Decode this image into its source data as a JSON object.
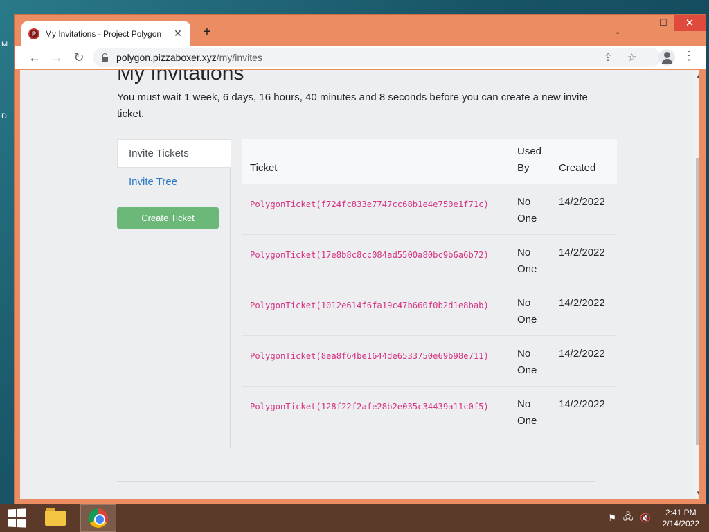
{
  "desktop": {
    "label_top": "M",
    "label_mid": "D"
  },
  "window": {
    "caption": {
      "minimize": "—",
      "maximize": "☐",
      "close": "✕"
    },
    "tab": {
      "title": "My Invitations - Project Polygon",
      "close": "✕",
      "favicon_letter": "P"
    },
    "new_tab": "+",
    "tab_search": "⌄",
    "toolbar": {
      "url_host": "polygon.pizzaboxer.xyz",
      "url_path": "/my/invites"
    }
  },
  "page": {
    "title": "My Invitations",
    "wait_message": "You must wait 1 week, 6 days, 16 hours, 40 minutes and 8 seconds before you can create a new invite ticket.",
    "sidebar": {
      "active_item": "Invite Tickets",
      "link_item": "Invite Tree",
      "create_button": "Create Ticket"
    },
    "table": {
      "headers": {
        "ticket": "Ticket",
        "used_by": "Used By",
        "created": "Created"
      },
      "rows": [
        {
          "ticket": "PolygonTicket(f724fc833e7747cc68b1e4e750e1f71c)",
          "used_by": "No One",
          "created": "14/2/2022"
        },
        {
          "ticket": "PolygonTicket(17e8b8c8cc084ad5500a80bc9b6a6b72)",
          "used_by": "No One",
          "created": "14/2/2022"
        },
        {
          "ticket": "PolygonTicket(1012e614f6fa19c47b660f0b2d1e8bab)",
          "used_by": "No One",
          "created": "14/2/2022"
        },
        {
          "ticket": "PolygonTicket(8ea8f64be1644de6533750e69b98e711)",
          "used_by": "No One",
          "created": "14/2/2022"
        },
        {
          "ticket": "PolygonTicket(128f22f2afe28b2e035c34439a11c0f5)",
          "used_by": "No One",
          "created": "14/2/2022"
        }
      ]
    }
  },
  "taskbar": {
    "clock_time": "2:41 PM",
    "clock_date": "2/14/2022"
  },
  "colors": {
    "window_frame": "#eb8c63",
    "link": "#2b78c5",
    "code": "#d63384",
    "create_button": "#6bb879",
    "taskbar": "#5c3a2a"
  }
}
